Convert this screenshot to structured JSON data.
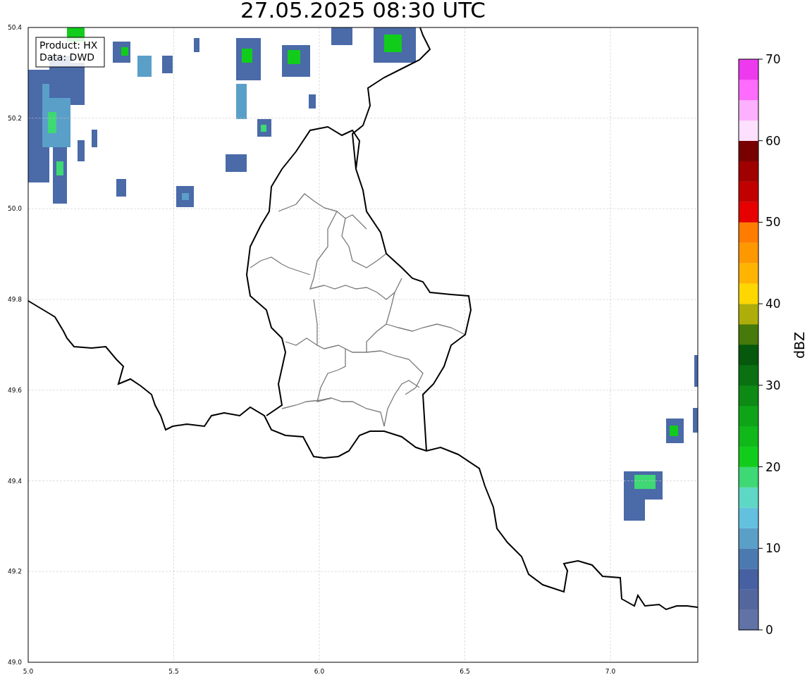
{
  "title": "27.05.2025 08:30 UTC",
  "info_box": [
    "Product: HX",
    "Data: DWD"
  ],
  "map": {
    "xticks": [
      "5.0",
      "5.5",
      "6.0",
      "6.5",
      "7.0"
    ],
    "yticks": [
      "50.4",
      "50.2",
      "50.0",
      "49.8",
      "49.6",
      "49.4",
      "49.2",
      "49.0"
    ]
  },
  "colorbar": {
    "label": "dBZ",
    "ticks": [
      "70",
      "60",
      "50",
      "40",
      "30",
      "20",
      "10",
      "0"
    ],
    "bands": [
      {
        "color": "#6173a6"
      },
      {
        "color": "#53679e"
      },
      {
        "color": "#4660a2"
      },
      {
        "color": "#4a7ab0"
      },
      {
        "color": "#5a9fc8"
      },
      {
        "color": "#63c0de"
      },
      {
        "color": "#5ed8c4"
      },
      {
        "color": "#3ed874"
      },
      {
        "color": "#12cc1c"
      },
      {
        "color": "#10b81a"
      },
      {
        "color": "#0ea418"
      },
      {
        "color": "#0c8a14"
      },
      {
        "color": "#0a7012"
      },
      {
        "color": "#06580c"
      },
      {
        "color": "#467a0a"
      },
      {
        "color": "#aeae0a"
      },
      {
        "color": "#fed600"
      },
      {
        "color": "#feb400"
      },
      {
        "color": "#fe9800"
      },
      {
        "color": "#fe7d00"
      },
      {
        "color": "#e60000"
      },
      {
        "color": "#c20000"
      },
      {
        "color": "#a00000"
      },
      {
        "color": "#780000"
      },
      {
        "color": "#fde0fd"
      },
      {
        "color": "#fdb0fd"
      },
      {
        "color": "#fd6cfd"
      },
      {
        "color": "#ee3aee"
      }
    ]
  }
}
